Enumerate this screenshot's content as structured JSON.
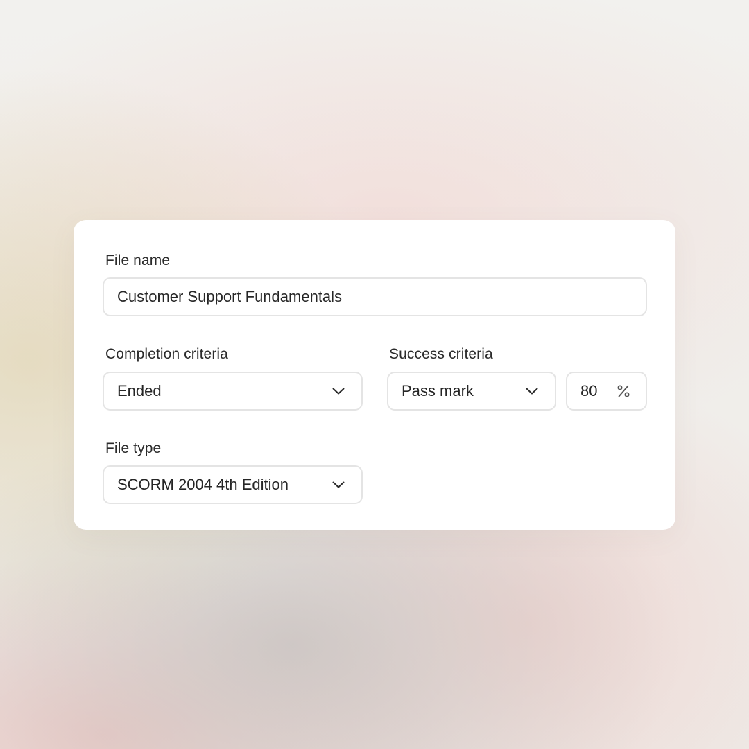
{
  "form": {
    "file_name": {
      "label": "File name",
      "value": "Customer Support Fundamentals"
    },
    "completion_criteria": {
      "label": "Completion criteria",
      "selected": "Ended"
    },
    "success_criteria": {
      "label": "Success criteria",
      "selected": "Pass mark",
      "pass_mark_value": "80",
      "unit_icon": "percent-icon"
    },
    "file_type": {
      "label": "File type",
      "selected": "SCORM 2004 4th Edition"
    }
  },
  "colors": {
    "card_background": "#ffffff",
    "field_border": "#e4e4e4",
    "text": "#262626"
  }
}
